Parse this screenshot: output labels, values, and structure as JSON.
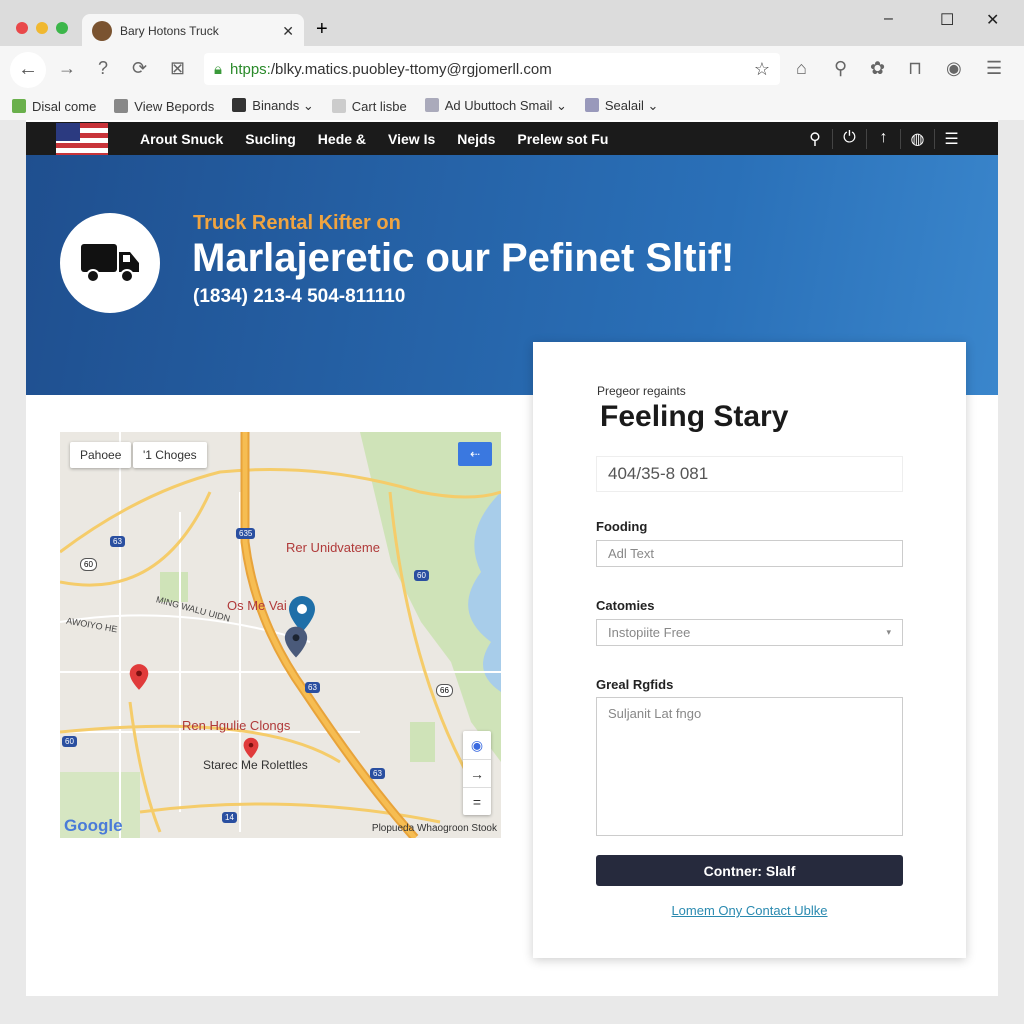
{
  "browser": {
    "tab_title": "Bary Hotons Truck",
    "url_scheme": "htpps:",
    "url_rest": "/blky.matics.puobley-ttomy@rgjomerll.com",
    "bookmarks": [
      "Disal come",
      "View Bepords",
      "Binands ⌄",
      "Cart lisbe",
      "Ad Ubuttoch Smail ⌄",
      "Sealail ⌄"
    ]
  },
  "site_nav": {
    "links": [
      "Arout Snuck",
      "Sucling",
      "Hede &",
      "View Is",
      "Nejds",
      "Prelew sot Fu"
    ]
  },
  "hero": {
    "kicker": "Truck Rental Kifter on",
    "title": "Marlajeretic our Pefinet Sltif!",
    "phone": "(1834) 213-4 504-811110"
  },
  "map": {
    "buttons": [
      "Pahoee",
      "'1 Choges"
    ],
    "labels": [
      "Rer Unidvateme",
      "Os Me Vai",
      "Ren Hgulie Clongs",
      "Starec Me Rolettles",
      "MING WALU UIDN",
      "AWOIYO HE"
    ],
    "shields": [
      "635",
      "63",
      "60",
      "60",
      "63",
      "66",
      "60",
      "63",
      "14"
    ],
    "attribution": "Plopueda Whaogroon Stook",
    "logo": "Google"
  },
  "form": {
    "eyebrow": "Pregeor regaints",
    "title": "Feeling Stary",
    "phone_value": "404/35-8 081",
    "field1_label": "Fooding",
    "field1_placeholder": "Adl Text",
    "field2_label": "Catomies",
    "field2_value": "Instopiite Free",
    "field3_label": "Greal Rgfids",
    "field3_placeholder": "Suljanit Lat fngo",
    "submit": "Contner: Slalf",
    "link": "Lomem Ony Contact Ublke"
  },
  "colors": {
    "hero": "#2a70b8",
    "nav": "#1b1b1b",
    "accent": "#f0a440",
    "button": "#262a3d"
  }
}
